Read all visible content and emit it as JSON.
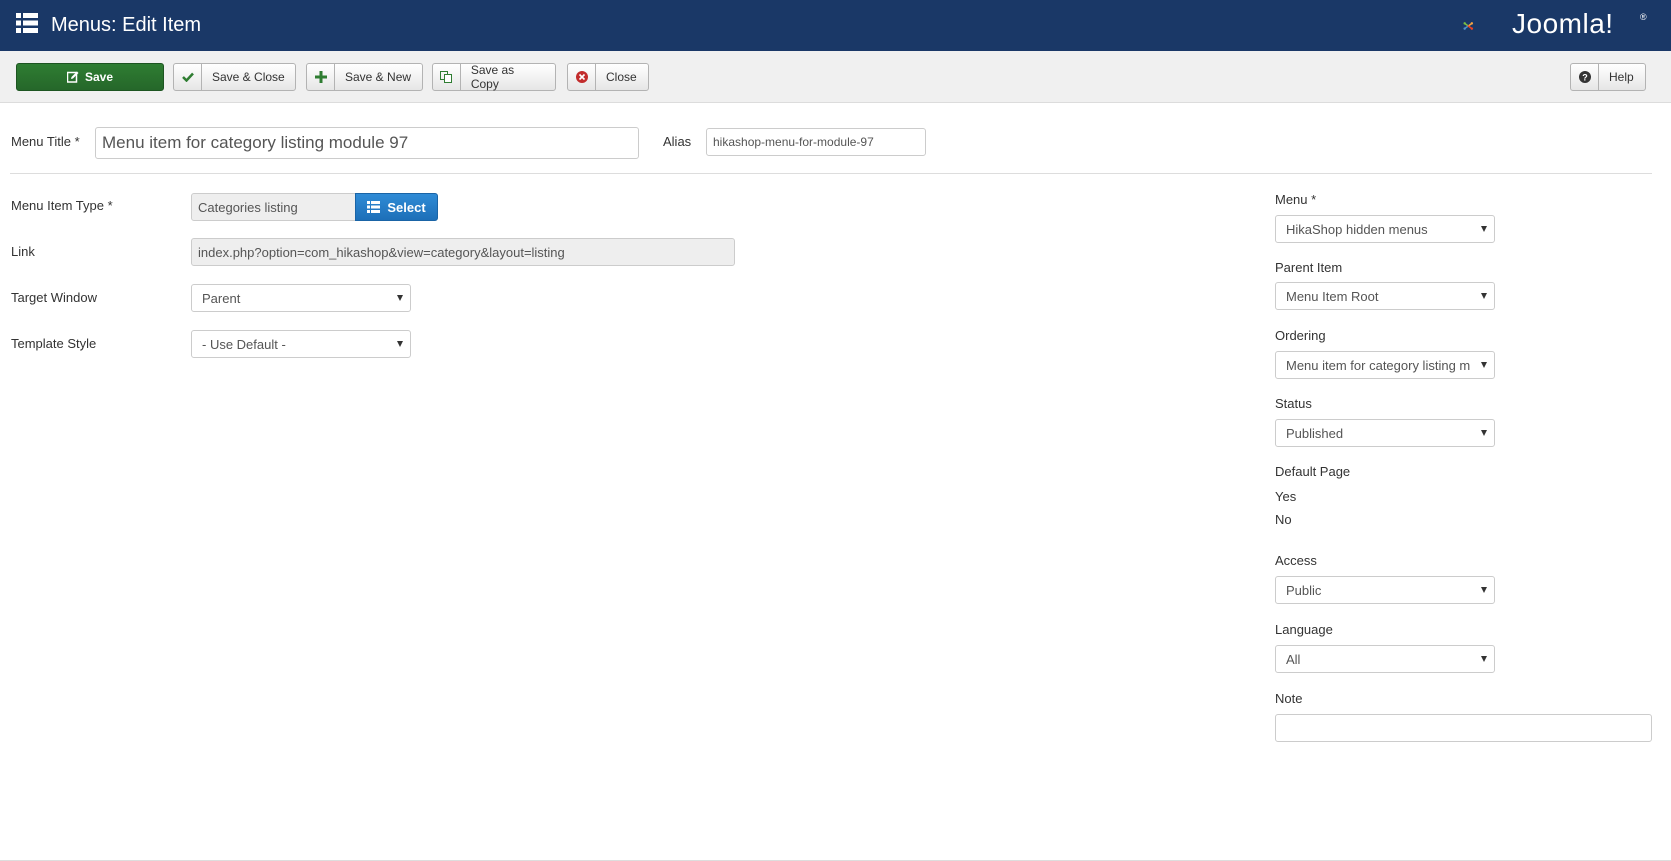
{
  "header": {
    "title": "Menus: Edit Item",
    "logo_text": "Joomla!",
    "logo_reg": "®",
    "background": "#1a3867"
  },
  "toolbar": {
    "save": "Save",
    "save_close": "Save & Close",
    "save_new": "Save & New",
    "save_copy": "Save as Copy",
    "close": "Close",
    "help": "Help"
  },
  "form": {
    "menu_title_label": "Menu Title *",
    "menu_title_value": "Menu item for category listing module 97",
    "alias_label": "Alias",
    "alias_value": "hikashop-menu-for-module-97",
    "menu_item_type_label": "Menu Item Type *",
    "menu_item_type_value": "Categories listing",
    "select_button": "Select",
    "link_label": "Link",
    "link_value": "index.php?option=com_hikashop&view=category&layout=listing",
    "target_window_label": "Target Window",
    "target_window_value": "Parent",
    "template_style_label": "Template Style",
    "template_style_value": "- Use Default -"
  },
  "sidebar": {
    "menu_label": "Menu *",
    "menu_value": "HikaShop hidden menus",
    "parent_item_label": "Parent Item",
    "parent_item_value": "Menu Item Root",
    "ordering_label": "Ordering",
    "ordering_value": "Menu item for category listing m",
    "status_label": "Status",
    "status_value": "Published",
    "default_page_label": "Default Page",
    "default_page_yes": "Yes",
    "default_page_no": "No",
    "access_label": "Access",
    "access_value": "Public",
    "language_label": "Language",
    "language_value": "All",
    "note_label": "Note",
    "note_value": ""
  },
  "colors": {
    "save_green": "#2f7d32",
    "select_blue": "#2384d3",
    "close_red": "#c22c2c",
    "check_green": "#2f7d32"
  }
}
